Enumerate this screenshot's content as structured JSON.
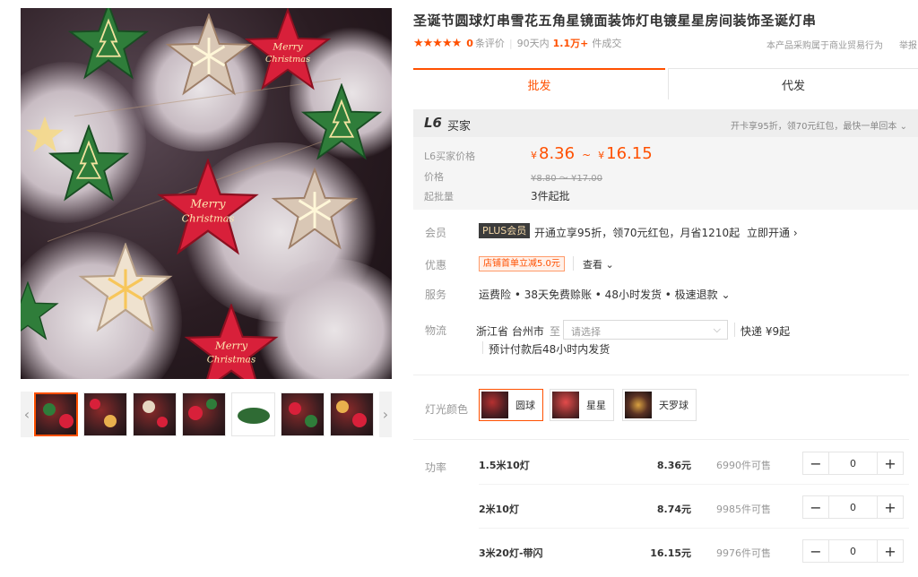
{
  "gallery": {
    "main_image_alt": "",
    "star_texts": [
      "Merry",
      "Christmas"
    ],
    "prev_icon": "chevron-left-icon",
    "next_icon": "chevron-right-icon"
  },
  "product": {
    "title": "圣诞节圆球灯串雪花五角星镜面装饰灯电镀星星房间装饰圣诞灯串",
    "stars": "★★★★★",
    "review_count": "0",
    "review_label": "条评价",
    "sold_prefix": "90天内",
    "sold_count": "1.1万+",
    "sold_suffix": "件成交",
    "purchase_note": "本产品采购属于商业贸易行为",
    "report": "举报"
  },
  "tabs": [
    {
      "label": "批发"
    },
    {
      "label": "代发"
    }
  ],
  "price_box": {
    "level_badge": "L6",
    "level_name": "买家",
    "level_perk": "开卡享95折，领70元红包，最快一单回本 ⌄",
    "l6_price_label": "L6买家价格",
    "currency": "¥",
    "price_low": "8.36",
    "tilde": "~",
    "price_high": "16.15",
    "orig_label": "价格",
    "orig_price": "¥8.80 ～ ¥17.00",
    "moq_label": "起批量",
    "moq_value": "3件起批"
  },
  "member": {
    "label": "会员",
    "badge": "PLUS会员",
    "text": "开通立享95折，领70元红包，月省1210起",
    "open_link": "立即开通 ›"
  },
  "promo": {
    "label": "优惠",
    "coupon": "店铺首单立减5.0元",
    "more": "查看 ⌄"
  },
  "service": {
    "label": "服务",
    "text": "运费险 • 38天免费赊账 • 48小时发货 • 极速退款 ⌄"
  },
  "logistics": {
    "label": "物流",
    "origin": "浙江省 台州市",
    "to": "至",
    "select_placeholder": "请选择",
    "fee": "快递  ¥9起",
    "ship_time": "预计付款后48小时内发货"
  },
  "color": {
    "label": "灯光颜色",
    "options": [
      {
        "label": "圆球",
        "selected": true
      },
      {
        "label": "星星",
        "selected": false
      },
      {
        "label": "天罗球",
        "selected": false
      }
    ]
  },
  "power": {
    "label": "功率",
    "rows": [
      {
        "name": "1.5米10灯",
        "price": "8.36元",
        "stock": "6990件可售",
        "qty": "0"
      },
      {
        "name": "2米10灯",
        "price": "8.74元",
        "stock": "9985件可售",
        "qty": "0"
      },
      {
        "name": "3米20灯-带闪",
        "price": "16.15元",
        "stock": "9976件可售",
        "qty": "0"
      }
    ],
    "minus": "−",
    "plus": "+"
  },
  "colors": {
    "accent": "#ff5000",
    "star_red": "#d8203a",
    "star_green": "#2f7d3a",
    "star_clear": "#d9c7b5"
  }
}
